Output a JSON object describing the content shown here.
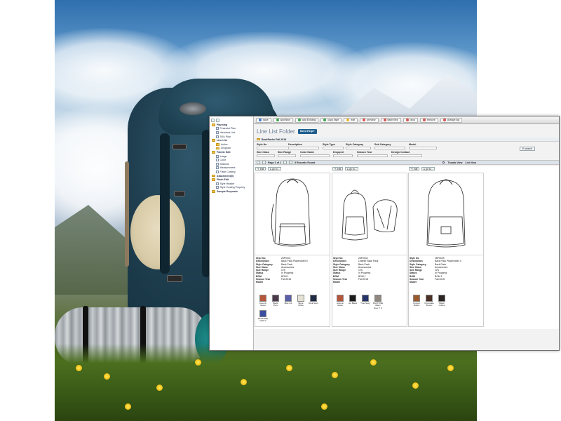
{
  "toolbar": {
    "buttons": [
      {
        "label": "save",
        "icon": "save-icon",
        "color": "#3a7bd5"
      },
      {
        "label": "add New",
        "icon": "add-icon",
        "color": "#3aa64a"
      },
      {
        "label": "add Existing",
        "icon": "add-existing-icon",
        "color": "#3aa64a"
      },
      {
        "label": "copy style",
        "icon": "copy-icon",
        "color": "#3aa64a"
      },
      {
        "label": "edit",
        "icon": "edit-icon",
        "color": "#f0b429"
      },
      {
        "label": "preview",
        "icon": "preview-icon",
        "color": "#d9534f"
      },
      {
        "label": "flash files",
        "icon": "flash-files-icon",
        "color": "#d9534f"
      },
      {
        "label": "drop",
        "icon": "drop-icon",
        "color": "#d9534f"
      },
      {
        "label": "remove",
        "icon": "remove-icon",
        "color": "#d9534f"
      },
      {
        "label": "change log",
        "icon": "change-log-icon",
        "color": "#d9534f"
      }
    ]
  },
  "tree": {
    "items": [
      {
        "label": "Planning",
        "level": 0,
        "icon": "folder-icon"
      },
      {
        "label": "Financial Plan",
        "level": 1,
        "icon": "document-icon"
      },
      {
        "label": "Historical List",
        "level": 1,
        "icon": "document-icon"
      },
      {
        "label": "SKU Plan",
        "level": 1,
        "icon": "document-icon"
      },
      {
        "label": "Line List",
        "level": 0,
        "icon": "folder-icon"
      },
      {
        "label": "Active",
        "level": 1,
        "icon": "folder-icon"
      },
      {
        "label": "Dropped",
        "level": 1,
        "icon": "folder-icon"
      },
      {
        "label": "Palette Edit",
        "level": 0,
        "icon": "folder-icon"
      },
      {
        "label": "Image",
        "level": 1,
        "icon": "document-icon"
      },
      {
        "label": "Color",
        "level": 1,
        "icon": "document-icon"
      },
      {
        "label": "Material",
        "level": 1,
        "icon": "document-icon"
      },
      {
        "label": "Measurement",
        "level": 1,
        "icon": "document-icon"
      },
      {
        "label": "Flash Costing",
        "level": 1,
        "icon": "document-icon"
      },
      {
        "label": "Attachment(0)",
        "level": 0,
        "icon": "folder-icon"
      },
      {
        "label": "Flash Edit",
        "level": 0,
        "icon": "folder-icon"
      },
      {
        "label": "Style Header",
        "level": 1,
        "icon": "document-icon"
      },
      {
        "label": "Style Costing Property",
        "level": 1,
        "icon": "document-icon"
      },
      {
        "label": "Sample Requests",
        "level": 0,
        "icon": "folder-icon"
      }
    ]
  },
  "main": {
    "title": "Line List Folder",
    "help_label": "Need Help?",
    "breadcrumb": "BackPacks Fall 2018",
    "filters": {
      "row1": [
        "Style No",
        "Description",
        "Style Type",
        "Style Category",
        "Sub Category",
        "Model"
      ],
      "row2": [
        "Size Class",
        "Size Range",
        "Color Name",
        "Dropped",
        "Season Year",
        "Design Contact"
      ],
      "search_label": "search"
    },
    "pager": {
      "page_text": "Page 1 of 1",
      "records_text": "3 Records Found",
      "thumb_view": "Thumb View",
      "list_view": "List View"
    },
    "card_buttons": {
      "edit": "edit",
      "goto": "go to..."
    }
  },
  "cards": [
    {
      "specs": [
        [
          "Style No",
          "28P0041"
        ],
        [
          "Description",
          "Back Pack\nPlaceholder 5"
        ],
        [
          "Style Category",
          "Back Pack"
        ],
        [
          "Size Class",
          "Accessories"
        ],
        [
          "Size Range",
          "O/S"
        ],
        [
          "Status",
          "In Progress"
        ],
        [
          "BOM",
          "BOM 1"
        ],
        [
          "Season Year",
          "Fall 2018"
        ],
        [
          "Model",
          ""
        ]
      ],
      "swatches": [
        {
          "name": "Autumn Glaze",
          "color": "#b5553a"
        },
        {
          "name": "Black Plum",
          "color": "#4a3a4c"
        },
        {
          "name": "Blue Iris",
          "color": "#5b5fa8"
        },
        {
          "name": "Bone White",
          "color": "#e4e0d3"
        },
        {
          "name": "Dark Navy",
          "color": "#1f2a44"
        },
        {
          "name": "PANTONE 2140 C",
          "color": "#3a4fa0"
        }
      ]
    },
    {
      "specs": [
        [
          "Style No",
          "28P0034"
        ],
        [
          "Description",
          "Leather Back\nPack"
        ],
        [
          "Style Category",
          "Back Pack"
        ],
        [
          "Size Class",
          "Accessories"
        ],
        [
          "Size Range",
          "O/S"
        ],
        [
          "Status",
          "In Progress"
        ],
        [
          "BOM",
          "BOM 1"
        ],
        [
          "Season Year",
          "Fall 2018"
        ],
        [
          "Model",
          ""
        ]
      ],
      "swatches": [
        {
          "name": "Autumn Glaze",
          "color": "#b5553a"
        },
        {
          "name": "Jet Black",
          "color": "#1b1b1b"
        },
        {
          "name": "True Navy",
          "color": "#26346a"
        },
        {
          "name": "PANTONE Warm Grey 7 C",
          "color": "#8f8780"
        }
      ]
    },
    {
      "specs": [
        [
          "Style No",
          "28P0039"
        ],
        [
          "Description",
          "Back Pack\nPlaceholder 4"
        ],
        [
          "Style Category",
          "Back Pack"
        ],
        [
          "Size Class",
          "Accessories"
        ],
        [
          "Size Range",
          "O/S"
        ],
        [
          "Status",
          "In Progress"
        ],
        [
          "BOM",
          "BOM 1"
        ],
        [
          "Season Year",
          "Fall 2018"
        ],
        [
          "Model",
          ""
        ]
      ],
      "swatches": [
        {
          "name": "Copper Brown",
          "color": "#9b5a2c"
        },
        {
          "name": "Chocolate Brown",
          "color": "#4a3026"
        },
        {
          "name": "Black Coffee",
          "color": "#2c2422"
        }
      ]
    }
  ]
}
